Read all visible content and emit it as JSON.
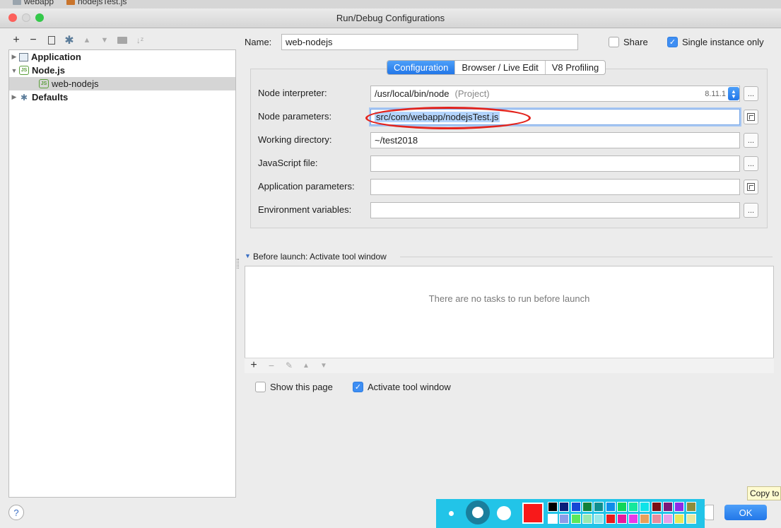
{
  "window": {
    "title": "Run/Debug Configurations",
    "traffic_colors": [
      "#fc605b",
      "#fdbc40",
      "#34c84a"
    ]
  },
  "editor_tabs": [
    "webapp",
    "nodejsTest.js"
  ],
  "tree": {
    "items": [
      {
        "label": "Application",
        "expanded": false
      },
      {
        "label": "Node.js",
        "expanded": true
      },
      {
        "label": "web-nodejs",
        "selected": true
      },
      {
        "label": "Defaults",
        "expanded": false
      }
    ]
  },
  "name_row": {
    "label": "Name:",
    "value": "web-nodejs",
    "share_label": "Share",
    "share_checked": false,
    "single_instance_label": "Single instance only",
    "single_instance_checked": true
  },
  "tabs": [
    {
      "label": "Configuration",
      "active": true
    },
    {
      "label": "Browser / Live Edit",
      "active": false
    },
    {
      "label": "V8 Profiling",
      "active": false
    }
  ],
  "form": {
    "node_interpreter": {
      "label": "Node interpreter:",
      "value": "/usr/local/bin/node",
      "hint": "(Project)",
      "version": "8.11.1"
    },
    "node_parameters": {
      "label": "Node parameters:",
      "value": "src/com/webapp/nodejsTest.js"
    },
    "working_directory": {
      "label": "Working directory:",
      "value": "~/test2018"
    },
    "javascript_file": {
      "label": "JavaScript file:",
      "value": ""
    },
    "application_parameters": {
      "label": "Application parameters:",
      "value": ""
    },
    "environment_variables": {
      "label": "Environment variables:",
      "value": ""
    },
    "browse_label": "..."
  },
  "before_launch": {
    "title": "Before launch: Activate tool window",
    "empty_text": "There are no tasks to run before launch",
    "show_page_label": "Show this page",
    "show_page_checked": false,
    "activate_label": "Activate tool window",
    "activate_checked": true
  },
  "footer": {
    "help_label": "?",
    "ok_label": "OK",
    "tooltip": "Copy to"
  },
  "annotation": {
    "highlight_color": "#e3241d",
    "palette_color": "#22c4e8",
    "current_color": "#f8191a",
    "swatches_top": [
      "#000000",
      "#0b1f7a",
      "#1747d6",
      "#11823b",
      "#0f8f8f",
      "#0f8de8",
      "#0fd65a",
      "#16e89c",
      "#0fe3e8",
      "#7a1017",
      "#7a1a7a",
      "#8c2ce8",
      "#8c8c3a"
    ],
    "swatches_bottom": [
      "#ffffff",
      "#8c9ce8",
      "#5ae85a",
      "#9ae8b0",
      "#9ae8e8",
      "#e81a1a",
      "#e81a9c",
      "#e83ae8",
      "#e8a05a",
      "#e88c9c",
      "#e8a0e8",
      "#e8e85a",
      "#e8e8a0"
    ]
  }
}
